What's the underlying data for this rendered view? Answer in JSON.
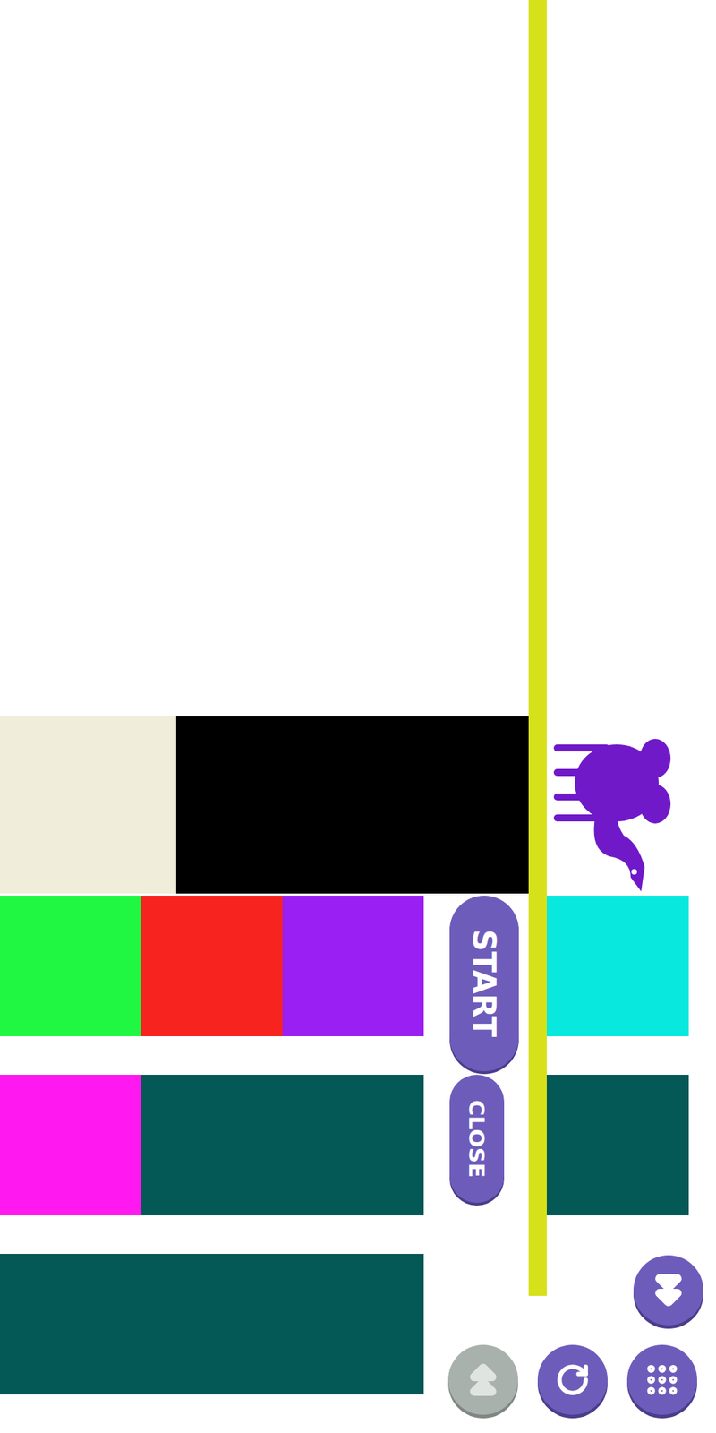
{
  "board": {
    "top_row": [
      {
        "color": "#f0eeda"
      },
      {
        "color": "#000000"
      }
    ],
    "tiles": [
      {
        "color": "#1ff742"
      },
      {
        "color": "#f7231e"
      },
      {
        "color": "#9a1ff2"
      },
      {
        "color": "#08e8de"
      },
      {
        "color": "#ff18ef"
      },
      {
        "color": "#045856"
      },
      {
        "color": "#045856"
      },
      {
        "color": "#045856"
      }
    ]
  },
  "buttons": [
    {
      "label": "START"
    },
    {
      "label": "CLOSE"
    }
  ],
  "nav_buttons": [
    {
      "name": "next",
      "disabled": false
    },
    {
      "name": "previous",
      "disabled": true
    },
    {
      "name": "restart",
      "disabled": false
    },
    {
      "name": "menu",
      "disabled": false
    }
  ]
}
